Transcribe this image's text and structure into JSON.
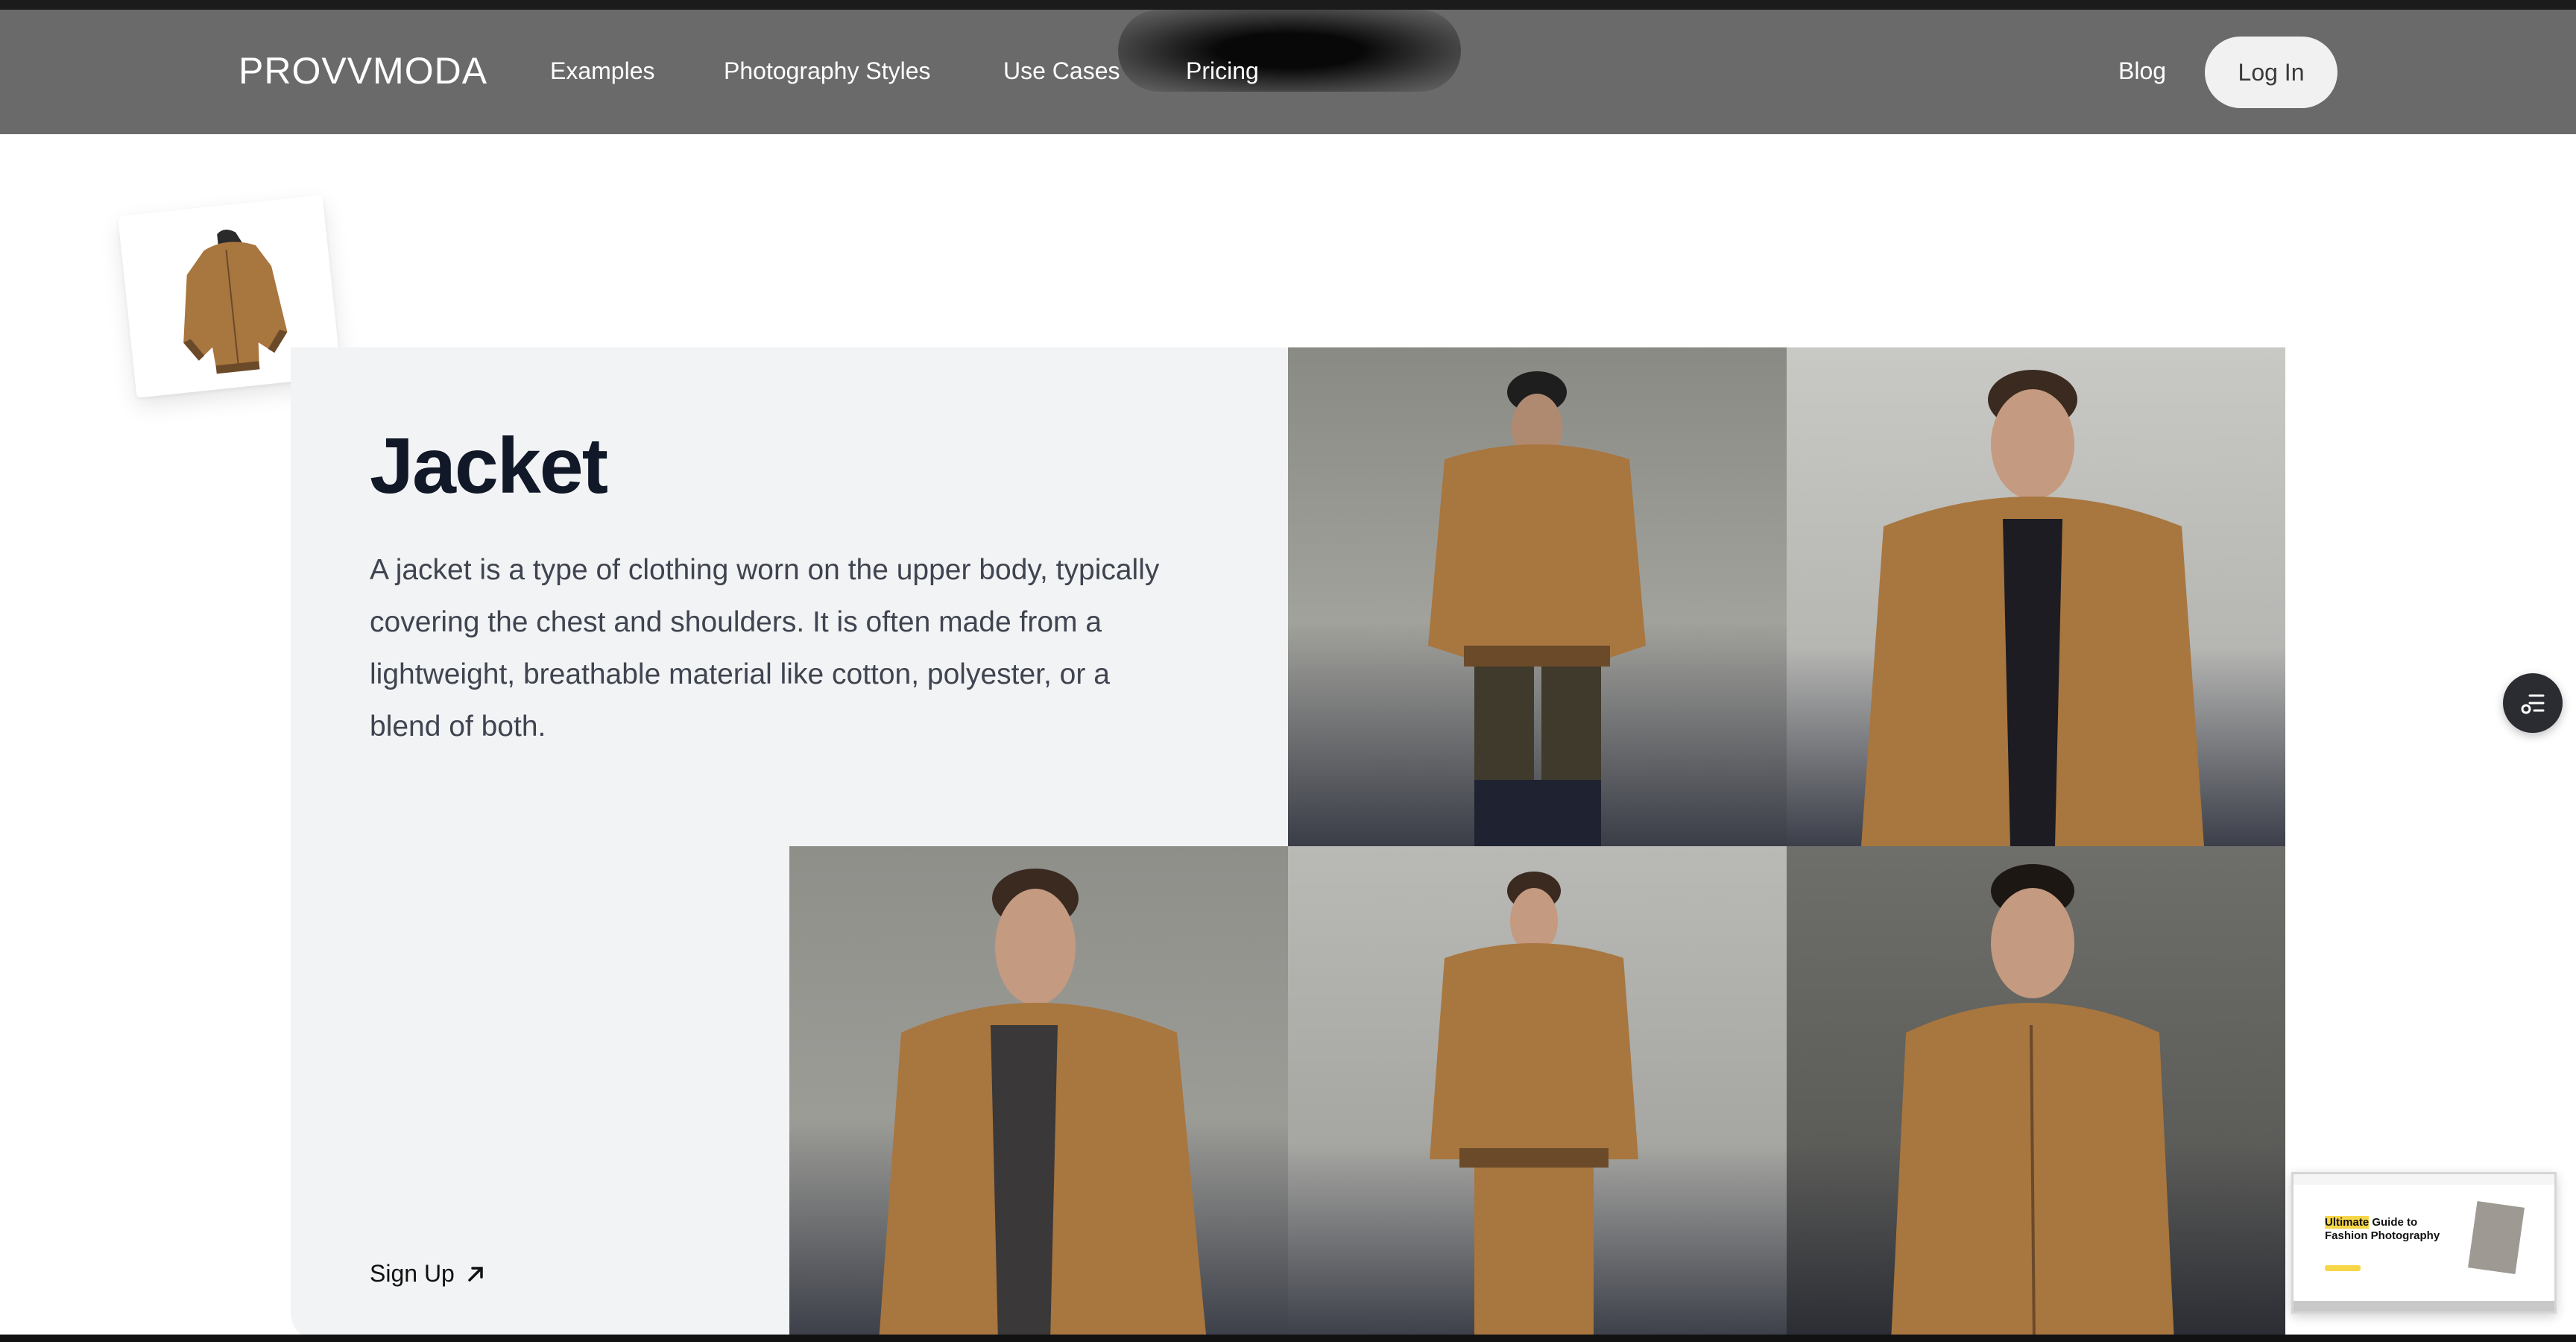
{
  "brand": {
    "logo_text": "PROVVMODA"
  },
  "nav": {
    "links": [
      "Examples",
      "Photography Styles",
      "Use Cases",
      "Pricing"
    ],
    "blog": "Blog",
    "login": "Log In"
  },
  "product": {
    "title": "Jacket",
    "description": "A jacket is a type of clothing worn on the upper body, typically covering the chest and shoulders. It is often made from a lightweight, breathable material like cotton, polyester, or a blend of both.",
    "cta": "Sign Up"
  },
  "preview": {
    "highlight": "Ultimate",
    "title_rest": " Guide to Fashion Photography"
  },
  "colors": {
    "nav_bg": "#6a6a6a",
    "panel_bg": "#f2f3f5",
    "jacket": "#a8763f",
    "text_dark": "#111827"
  }
}
